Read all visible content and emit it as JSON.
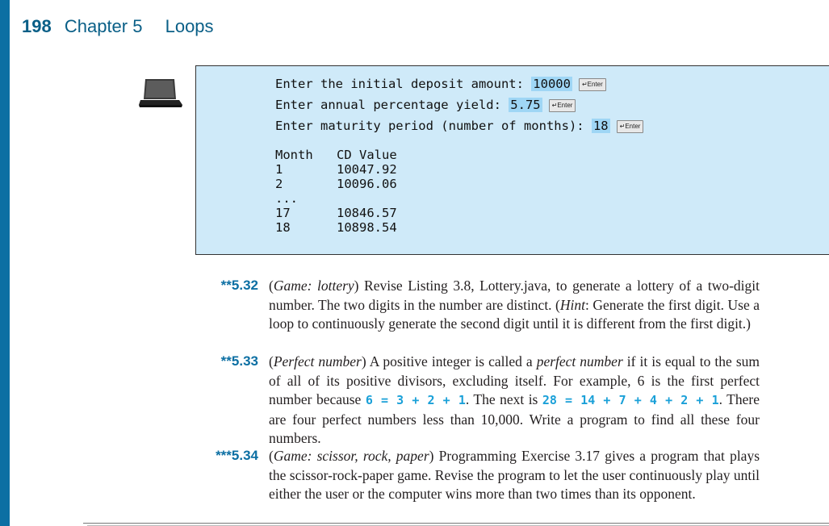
{
  "header": {
    "page_number": "198",
    "chapter": "Chapter 5",
    "title": "Loops"
  },
  "console": {
    "prompts": [
      {
        "text": "Enter the initial deposit amount: ",
        "value": "10000",
        "key": "↵Enter"
      },
      {
        "text": "Enter annual percentage yield: ",
        "value": "5.75",
        "key": "↵Enter"
      },
      {
        "text": "Enter maturity period (number of months): ",
        "value": "18",
        "key": "↵Enter"
      }
    ],
    "table_header": {
      "month": "Month",
      "value": "CD Value"
    },
    "rows": [
      {
        "month": "1",
        "value": "10047.92"
      },
      {
        "month": "2",
        "value": "10096.06"
      },
      {
        "month": "...",
        "value": ""
      },
      {
        "month": "17",
        "value": "10846.57"
      },
      {
        "month": "18",
        "value": "10898.54"
      }
    ]
  },
  "exercises": [
    {
      "number": "**5.32",
      "parts": [
        "(",
        "Game: lottery",
        ") Revise Listing 3.8, Lottery.java, to generate a lottery of a two-digit number. The two digits in the number are distinct. (",
        "Hint",
        ": Generate the first digit. Use a loop to continuously generate the second digit until it is different from the first digit.)"
      ]
    },
    {
      "number": "**5.33",
      "parts": [
        "(",
        "Perfect number",
        ") A positive integer is called a ",
        "perfect number",
        " if it is equal to the sum of all of its positive divisors, excluding itself. For example, 6 is the first perfect number because ",
        "6 = 3 + 2 + 1",
        ". The next is ",
        "28 = 14 + 7 + 4 + 2 + 1",
        ". There are four perfect numbers less than 10,000. Write a program to find all these four numbers."
      ]
    },
    {
      "number": "***5.34",
      "parts": [
        "(",
        "Game: scissor, rock, paper",
        ") Programming Exercise  3.17 gives a program that plays the scissor-rock-paper game. Revise the program to let the user continuously play until either the user or the computer wins more than two times than its opponent."
      ]
    }
  ]
}
